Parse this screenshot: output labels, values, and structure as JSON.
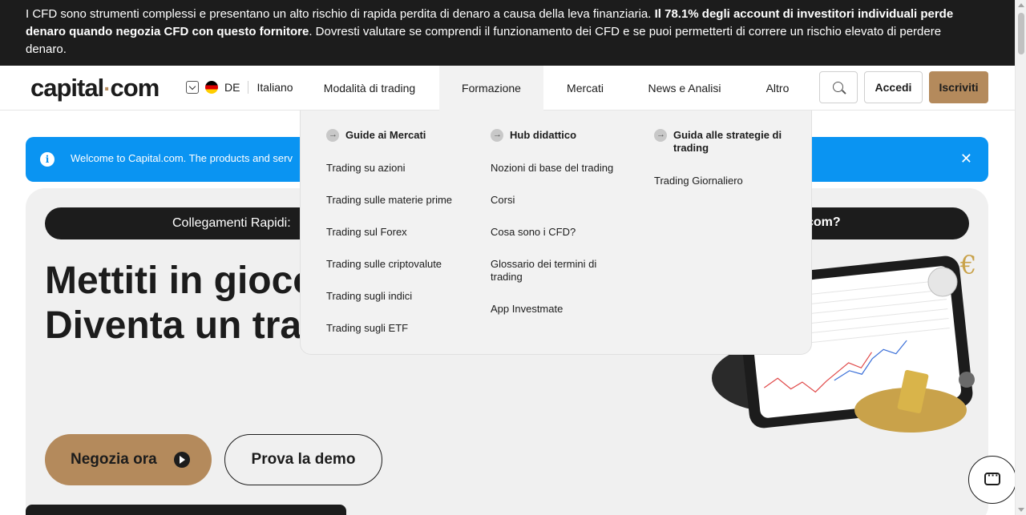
{
  "risk_warning": {
    "part1": "I CFD sono strumenti complessi e presentano un alto rischio di rapida perdita di denaro a causa della leva finanziaria. ",
    "bold": "Il 78.1% degli account di investitori individuali perde denaro quando negozia CFD con questo fornitore",
    "part2": ". Dovresti valutare se comprendi il funzionamento dei CFD e se puoi permetterti di correre un rischio elevato di perdere denaro."
  },
  "header": {
    "logo_left": "capital",
    "logo_dot": "·",
    "logo_right": "com",
    "country": "DE",
    "language": "Italiano",
    "nav": [
      "Modalità di trading",
      "Formazione",
      "Mercati",
      "News e Analisi",
      "Altro"
    ],
    "active_nav": "Formazione",
    "login_label": "Accedi",
    "signup_label": "Iscriviti"
  },
  "welcome_banner": {
    "text": "Welcome to Capital.com. The products and serv",
    "close": "✕"
  },
  "hero": {
    "quick_links_label": "Collegamenti Rapidi:",
    "quick_links_right": "com?",
    "headline_line1": "Mettiti in gioco",
    "headline_line2": "Diventa un tra",
    "cta_primary": "Negozia ora",
    "cta_secondary": "Prova la demo"
  },
  "dropdown": {
    "columns": [
      {
        "heading": "Guide ai Mercati",
        "links": [
          "Trading su azioni",
          "Trading sulle materie prime",
          "Trading sul Forex",
          "Trading sulle criptovalute",
          "Trading sugli indici",
          "Trading sugli ETF"
        ]
      },
      {
        "heading": "Hub didattico",
        "links": [
          "Nozioni di base del trading",
          "Corsi",
          "Cosa sono i CFD?",
          "Glossario dei termini di trading",
          "App Investmate"
        ]
      },
      {
        "heading": "Guida alle strategie di trading",
        "links": [
          "Trading Giornaliero"
        ]
      }
    ]
  },
  "colors": {
    "brand_gold": "#b48a5c",
    "banner_blue": "#0a94f2",
    "dark": "#1c1c1c"
  },
  "icons": [
    "info-icon",
    "close-icon",
    "search-icon",
    "chevron-down-icon",
    "flag-de-icon",
    "arrow-right-icon",
    "play-icon",
    "chat-icon"
  ]
}
